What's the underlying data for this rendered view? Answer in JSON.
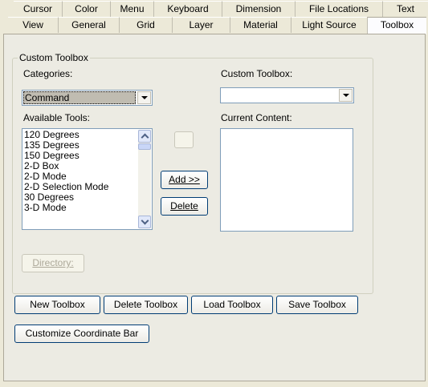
{
  "tabs_row1": [
    "Cursor",
    "Color",
    "Menu",
    "Keyboard",
    "Dimension",
    "File Locations",
    "Text"
  ],
  "tabs_row2": [
    "View",
    "General",
    "Grid",
    "Layer",
    "Material",
    "Light Source",
    "Toolbox"
  ],
  "active_tab": "Toolbox",
  "group": {
    "title": "Custom Toolbox",
    "categories_label": "Categories:",
    "categories_value": "Command",
    "available_label": "Available Tools:",
    "available_items": [
      "120 Degrees",
      "135 Degrees",
      "150 Degrees",
      "2-D Box",
      "2-D Mode",
      "2-D Selection Mode",
      "30 Degrees",
      "3-D Mode"
    ],
    "custom_toolbox_label": "Custom Toolbox:",
    "custom_toolbox_value": "",
    "current_content_label": "Current Content:",
    "current_content_items": [],
    "add_label": "Add >>",
    "delete_label": "Delete",
    "directory_label": "Directory:"
  },
  "buttons": {
    "new_toolbox": "New Toolbox",
    "delete_toolbox": "Delete Toolbox",
    "load_toolbox": "Load Toolbox",
    "save_toolbox": "Save Toolbox",
    "customize_coordinate_bar": "Customize Coordinate Bar"
  }
}
